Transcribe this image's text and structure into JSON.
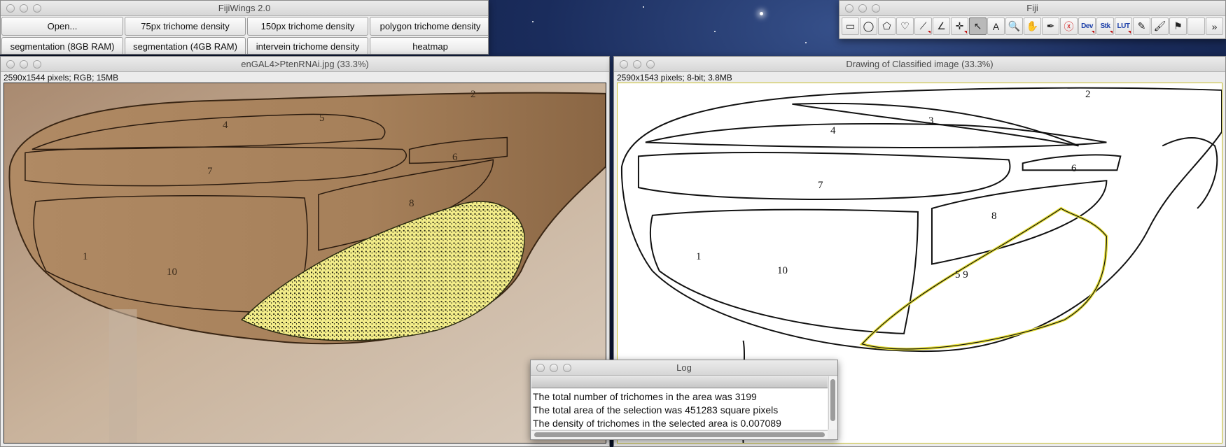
{
  "fijiwings": {
    "title": "FijiWings 2.0",
    "buttons": [
      "Open...",
      "75px trichome density",
      "150px trichome density",
      "polygon trichome density",
      "segmentation (8GB RAM)",
      "segmentation (4GB RAM)",
      "intervein trichome density",
      "heatmap"
    ]
  },
  "fiji": {
    "title": "Fiji",
    "tools": [
      {
        "name": "rectangle-tool-icon",
        "glyph": "▭"
      },
      {
        "name": "oval-tool-icon",
        "glyph": "◯"
      },
      {
        "name": "polygon-tool-icon",
        "glyph": "⬠"
      },
      {
        "name": "freehand-tool-icon",
        "glyph": "♡"
      },
      {
        "name": "line-tool-icon",
        "glyph": "⟋"
      },
      {
        "name": "angle-tool-icon",
        "glyph": "∠"
      },
      {
        "name": "point-tool-icon",
        "glyph": "✛"
      },
      {
        "name": "wand-tool-icon",
        "glyph": "↖"
      },
      {
        "name": "text-tool-icon",
        "glyph": "A"
      },
      {
        "name": "magnifier-tool-icon",
        "glyph": "🔍"
      },
      {
        "name": "hand-tool-icon",
        "glyph": "✋"
      },
      {
        "name": "dropper-tool-icon",
        "glyph": "✒"
      },
      {
        "name": "close-x-tool-icon",
        "glyph": "ⓧ"
      },
      {
        "name": "dev-tool-icon",
        "glyph": "Dev"
      },
      {
        "name": "stk-tool-icon",
        "glyph": "Stk"
      },
      {
        "name": "lut-tool-icon",
        "glyph": "LUT"
      },
      {
        "name": "pencil-tool-icon",
        "glyph": "✎"
      },
      {
        "name": "brush-tool-icon",
        "glyph": "🖌"
      },
      {
        "name": "flood-fill-tool-icon",
        "glyph": "⚑"
      },
      {
        "name": "empty-tool-slot",
        "glyph": ""
      },
      {
        "name": "more-tools-icon",
        "glyph": "»"
      }
    ],
    "active_tool_index": 7
  },
  "wing_window": {
    "title": "enGAL4>PtenRNAi.jpg (33.3%)",
    "info": "2590x1544 pixels; RGB; 15MB",
    "labels": [
      "1",
      "2",
      "4",
      "5",
      "6",
      "7",
      "8",
      "10"
    ]
  },
  "drawing_window": {
    "title": "Drawing of Classified image (33.3%)",
    "info": "2590x1543 pixels; 8-bit; 3.8MB",
    "labels": [
      "1",
      "2",
      "3",
      "4",
      "5 9",
      "6",
      "7",
      "8",
      "10"
    ]
  },
  "log": {
    "title": "Log",
    "lines": [
      "The total number of trichomes in the area was 3199",
      "The total area of the selection was 451283 square pixels",
      "The density of trichomes in the selected area is 0.007089"
    ]
  },
  "colors": {
    "selection": "#f2ec3c",
    "wing_tint": "#b08a64"
  }
}
